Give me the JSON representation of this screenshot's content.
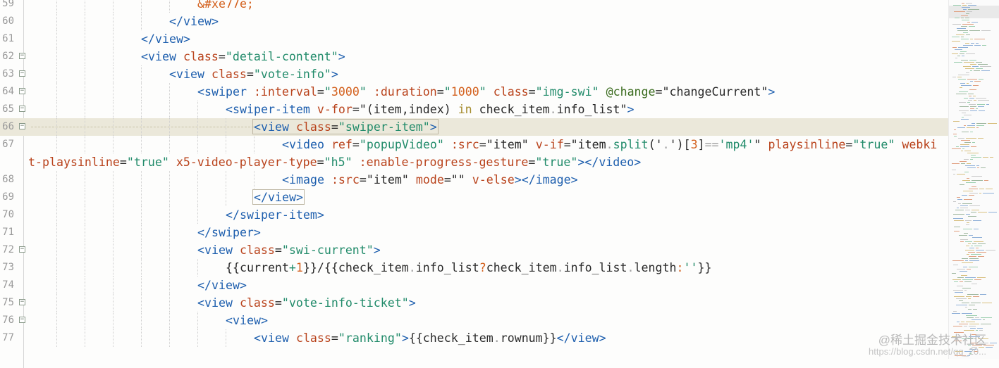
{
  "editor": {
    "lines": [
      {
        "num": "59",
        "fold": false,
        "hl": false,
        "indent": 6,
        "tokens": [
          [
            "n",
            "&#xe77e;"
          ]
        ]
      },
      {
        "num": "60",
        "fold": false,
        "hl": false,
        "indent": 5,
        "tokens": [
          [
            "t",
            "</view>"
          ]
        ]
      },
      {
        "num": "61",
        "fold": false,
        "hl": false,
        "indent": 4,
        "tokens": [
          [
            "t",
            "</view>"
          ]
        ]
      },
      {
        "num": "62",
        "fold": true,
        "hl": false,
        "indent": 4,
        "tokens": [
          [
            "t",
            "<view "
          ],
          [
            "a",
            "class"
          ],
          [
            "p",
            "="
          ],
          [
            "s",
            "\"detail-content\""
          ],
          [
            "t",
            ">"
          ]
        ]
      },
      {
        "num": "63",
        "fold": true,
        "hl": false,
        "indent": 5,
        "tokens": [
          [
            "t",
            "<view "
          ],
          [
            "a",
            "class"
          ],
          [
            "p",
            "="
          ],
          [
            "s",
            "\"vote-info\""
          ],
          [
            "t",
            ">"
          ]
        ]
      },
      {
        "num": "64",
        "fold": true,
        "hl": false,
        "indent": 6,
        "tokens": [
          [
            "t",
            "<swiper "
          ],
          [
            "a",
            ":interval"
          ],
          [
            "p",
            "="
          ],
          [
            "s",
            "\""
          ],
          [
            "n",
            "3000"
          ],
          [
            "s",
            "\""
          ],
          [
            "p",
            " "
          ],
          [
            "a",
            ":duration"
          ],
          [
            "p",
            "="
          ],
          [
            "s",
            "\""
          ],
          [
            "n",
            "1000"
          ],
          [
            "s",
            "\""
          ],
          [
            "p",
            " "
          ],
          [
            "a",
            "class"
          ],
          [
            "p",
            "="
          ],
          [
            "s",
            "\"img-swi\""
          ],
          [
            "p",
            " "
          ],
          [
            "ev",
            "@change"
          ],
          [
            "p",
            "=\"changeCurrent\""
          ],
          [
            "t",
            ">"
          ]
        ]
      },
      {
        "num": "65",
        "fold": true,
        "hl": false,
        "indent": 7,
        "tokens": [
          [
            "t",
            "<swiper-item "
          ],
          [
            "a",
            "v-for"
          ],
          [
            "p",
            "=\"(item,index) "
          ],
          [
            "k",
            "in"
          ],
          [
            "p",
            " check_item"
          ],
          [
            "pn",
            "."
          ],
          [
            "p",
            "info_list\""
          ],
          [
            "t",
            ">"
          ]
        ]
      },
      {
        "num": "66",
        "fold": true,
        "hl": true,
        "indent": 8,
        "tokens": [
          [
            "t",
            "<view "
          ],
          [
            "a",
            "class"
          ],
          [
            "p",
            "="
          ],
          [
            "s",
            "\"swiper-item\""
          ],
          [
            "t",
            ">"
          ]
        ]
      },
      {
        "num": "67",
        "fold": false,
        "hl": false,
        "indent": 9,
        "tokens": [
          [
            "t",
            "<video "
          ],
          [
            "a",
            "ref"
          ],
          [
            "p",
            "="
          ],
          [
            "s",
            "\"popupVideo\""
          ],
          [
            "p",
            " "
          ],
          [
            "a",
            ":src"
          ],
          [
            "p",
            "=\"item\" "
          ],
          [
            "a",
            "v-if"
          ],
          [
            "p",
            "=\"item"
          ],
          [
            "pn",
            "."
          ],
          [
            "s",
            "split"
          ],
          [
            "p",
            "('"
          ],
          [
            "pn",
            "."
          ],
          [
            "p",
            "')["
          ],
          [
            "n",
            "3"
          ],
          [
            "p",
            "]"
          ],
          [
            "pn",
            "=="
          ],
          [
            "s",
            "'mp4'"
          ],
          [
            "p",
            "\" "
          ],
          [
            "a",
            "playsinline"
          ],
          [
            "p",
            "="
          ],
          [
            "s",
            "\"true\""
          ],
          [
            "p",
            " "
          ],
          [
            "a",
            "webki"
          ]
        ]
      },
      {
        "num": "",
        "fold": false,
        "hl": false,
        "indent": 0,
        "tokens": [
          [
            "a",
            "t-playsinline"
          ],
          [
            "p",
            "="
          ],
          [
            "s",
            "\"true\""
          ],
          [
            "p",
            " "
          ],
          [
            "a",
            "x5-video-player-type"
          ],
          [
            "p",
            "="
          ],
          [
            "s",
            "\"h5\""
          ],
          [
            "p",
            " "
          ],
          [
            "a",
            ":enable-progress-gesture"
          ],
          [
            "p",
            "="
          ],
          [
            "s",
            "\"true\""
          ],
          [
            "t",
            "></video>"
          ]
        ]
      },
      {
        "num": "68",
        "fold": false,
        "hl": false,
        "indent": 9,
        "tokens": [
          [
            "t",
            "<image "
          ],
          [
            "a",
            ":src"
          ],
          [
            "p",
            "=\"item\" "
          ],
          [
            "a",
            "mode"
          ],
          [
            "p",
            "=\"\" "
          ],
          [
            "a",
            "v-else"
          ],
          [
            "t",
            "></image>"
          ]
        ]
      },
      {
        "num": "69",
        "fold": false,
        "hl": false,
        "indent": 8,
        "tokens": [
          [
            "t",
            "</view>"
          ]
        ]
      },
      {
        "num": "70",
        "fold": false,
        "hl": false,
        "indent": 7,
        "tokens": [
          [
            "t",
            "</swiper-item>"
          ]
        ]
      },
      {
        "num": "71",
        "fold": false,
        "hl": false,
        "indent": 6,
        "tokens": [
          [
            "t",
            "</swiper>"
          ]
        ]
      },
      {
        "num": "72",
        "fold": true,
        "hl": false,
        "indent": 6,
        "tokens": [
          [
            "t",
            "<view "
          ],
          [
            "a",
            "class"
          ],
          [
            "p",
            "="
          ],
          [
            "s",
            "\"swi-current\""
          ],
          [
            "t",
            ">"
          ]
        ]
      },
      {
        "num": "73",
        "fold": false,
        "hl": false,
        "indent": 7,
        "tokens": [
          [
            "p",
            "{{current"
          ],
          [
            "s",
            "+"
          ],
          [
            "n",
            "1"
          ],
          [
            "p",
            "}}/{{check_item"
          ],
          [
            "pn",
            "."
          ],
          [
            "p",
            "info_list"
          ],
          [
            "n",
            "?"
          ],
          [
            "p",
            "check_item"
          ],
          [
            "pn",
            "."
          ],
          [
            "p",
            "info_list"
          ],
          [
            "pn",
            "."
          ],
          [
            "p",
            "length"
          ],
          [
            "n",
            ":"
          ],
          [
            "s",
            "''"
          ],
          [
            "p",
            "}}"
          ]
        ]
      },
      {
        "num": "74",
        "fold": false,
        "hl": false,
        "indent": 6,
        "tokens": [
          [
            "t",
            "</view>"
          ]
        ]
      },
      {
        "num": "75",
        "fold": true,
        "hl": false,
        "indent": 6,
        "tokens": [
          [
            "t",
            "<view "
          ],
          [
            "a",
            "class"
          ],
          [
            "p",
            "="
          ],
          [
            "s",
            "\"vote-info-ticket\""
          ],
          [
            "t",
            ">"
          ]
        ]
      },
      {
        "num": "76",
        "fold": true,
        "hl": false,
        "indent": 7,
        "tokens": [
          [
            "t",
            "<view>"
          ]
        ]
      },
      {
        "num": "77",
        "fold": false,
        "hl": false,
        "indent": 8,
        "tokens": [
          [
            "t",
            "<view "
          ],
          [
            "a",
            "class"
          ],
          [
            "p",
            "="
          ],
          [
            "s",
            "\"ranking\""
          ],
          [
            "t",
            ">"
          ],
          [
            "p",
            "{{check_item"
          ],
          [
            "pn",
            "."
          ],
          [
            "p",
            "rownum}}"
          ],
          [
            "t",
            "</view>"
          ]
        ]
      }
    ]
  },
  "watermark": {
    "line1": "@稀土掘金技术社区",
    "line2": "https://blog.csdn.net/qq_20..."
  },
  "colors": {
    "tag": "#1e5fae",
    "attribute": "#b9431c",
    "string": "#218b6a",
    "number": "#d3601d",
    "keyword": "#a58c2e",
    "highlight": "#ebe8da"
  }
}
